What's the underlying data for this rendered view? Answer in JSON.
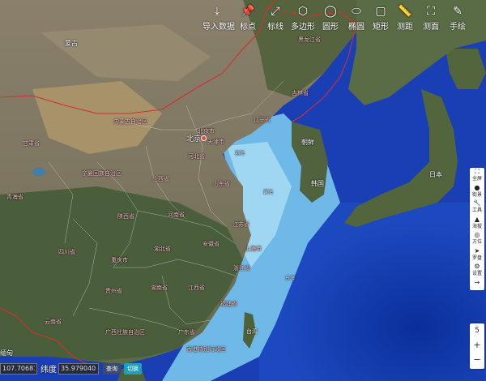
{
  "toolbar": {
    "items": [
      {
        "label": "导入数据",
        "icon": "download-icon",
        "glyph": "⤓"
      },
      {
        "label": "标点",
        "icon": "pushpin-icon",
        "glyph": "📌"
      },
      {
        "label": "标线",
        "icon": "line-icon",
        "glyph": "⤢"
      },
      {
        "label": "多边形",
        "icon": "hexagon-icon",
        "glyph": "⬡"
      },
      {
        "label": "圆形",
        "icon": "circle-icon",
        "glyph": "◯"
      },
      {
        "label": "椭圆",
        "icon": "ellipse-icon",
        "glyph": "⬭"
      },
      {
        "label": "矩形",
        "icon": "rectangle-icon",
        "glyph": "▢"
      },
      {
        "label": "测距",
        "icon": "ruler-icon",
        "glyph": "📏"
      },
      {
        "label": "测面",
        "icon": "area-measure-icon",
        "glyph": "⛶"
      },
      {
        "label": "手绘",
        "icon": "hand-draw-icon",
        "glyph": "✎"
      }
    ]
  },
  "rightpanel": {
    "items": [
      {
        "label": "全屏",
        "icon": "fullscreen-icon",
        "glyph": "⛶"
      },
      {
        "label": "街景",
        "icon": "street-view-icon",
        "glyph": "●"
      },
      {
        "label": "工具",
        "icon": "wrench-icon",
        "glyph": "🔧"
      },
      {
        "label": "海拔",
        "icon": "elevation-icon",
        "glyph": "▲"
      },
      {
        "label": "方位",
        "icon": "compass-icon",
        "glyph": "◎"
      },
      {
        "label": "罗盘",
        "icon": "navigation-icon",
        "glyph": "➤"
      },
      {
        "label": "设置",
        "icon": "gear-icon",
        "glyph": "⚙"
      },
      {
        "label": "",
        "icon": "arrow-right-icon",
        "glyph": "→"
      }
    ]
  },
  "zoom": {
    "level": "5",
    "plus": "+",
    "minus": "−"
  },
  "coords": {
    "longitude": "107.706810",
    "latitude_label": "纬度",
    "latitude": "35.979040",
    "query": "查询",
    "switch": "切换"
  },
  "map_labels": {
    "mongolia": "蒙古",
    "heilongjiang": "黑龙江省",
    "jilin": "吉林省",
    "liaoning": "辽宁省",
    "innermongolia": "内蒙古自治区",
    "beijing": "北京",
    "beijing_city": "北京市",
    "tianjin": "天津市",
    "hebei": "河北省",
    "shanxi": "山西省",
    "shandong": "山东省",
    "henan": "河南省",
    "ningxia": "宁夏回族自治区",
    "gansu": "甘肃省",
    "shaanxi": "陕西省",
    "qinghai": "青海省",
    "sichuan": "四川省",
    "chongqing": "重庆市",
    "hubei": "湖北省",
    "anhui": "安徽省",
    "jiangsu": "江苏省",
    "shanghai": "上海市",
    "zhejiang": "浙江省",
    "hunan": "湖南省",
    "jiangxi": "江西省",
    "guizhou": "贵州省",
    "fujian": "福建省",
    "yunnan": "云南省",
    "guangxi": "广西壮族自治区",
    "guangdong": "广东省",
    "taiwan": "台湾",
    "hongkong": "香港特别行政区",
    "northkorea": "朝鲜",
    "southkorea": "韩国",
    "japan": "日本",
    "yellowsea": "黄海",
    "bohai": "渤海",
    "eastchina": "东海",
    "myanmar": "缅甸"
  }
}
